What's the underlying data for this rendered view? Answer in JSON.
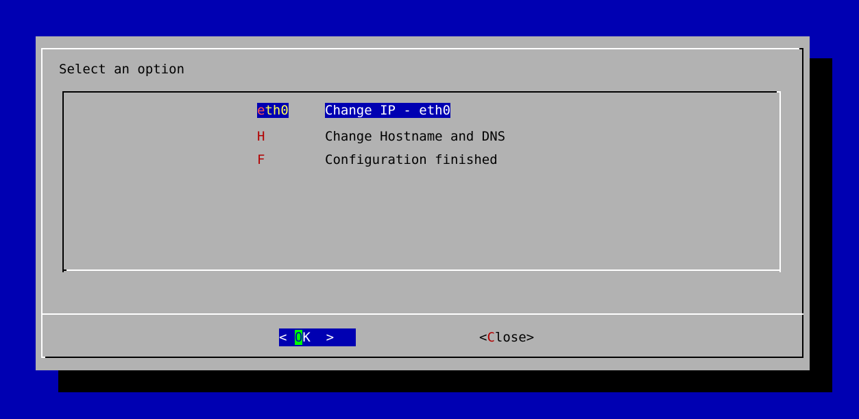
{
  "dialog": {
    "prompt": "Select an option",
    "menu": [
      {
        "tag_hot": "e",
        "tag_rest": "th0",
        "label": "Change IP - eth0",
        "selected": true
      },
      {
        "tag_hot": "H",
        "tag_rest": "",
        "label": "Change Hostname and DNS",
        "selected": false
      },
      {
        "tag_hot": "F",
        "tag_rest": "",
        "label": "Configuration finished",
        "selected": false
      }
    ],
    "buttons": {
      "ok": {
        "left": "< ",
        "cursor": "O",
        "rest": "K  >"
      },
      "close": {
        "left": "<",
        "hot": "C",
        "rest": "lose>"
      }
    }
  },
  "colors": {
    "background": "#0000b2",
    "dialog": "#b2b2b2",
    "hotkey": "#b20000",
    "cursor": "#00ff00"
  }
}
